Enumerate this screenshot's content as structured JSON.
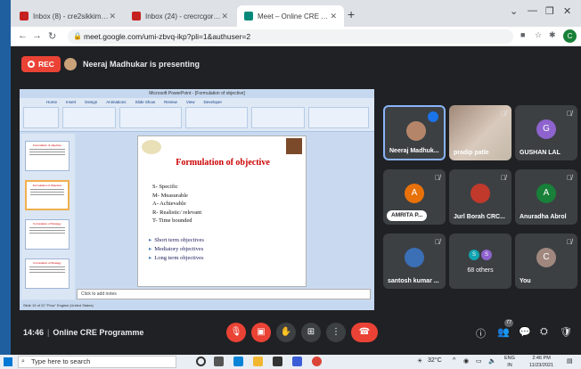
{
  "browser": {
    "tabs": [
      {
        "label": "Inbox (8) - cre2sikkim@gmail.co...",
        "favicon_color": "#c5221f",
        "active": false
      },
      {
        "label": "Inbox (24) - crecrcgorakhpur202...",
        "favicon_color": "#c5221f",
        "active": false
      },
      {
        "label": "Meet – Online CRE Programme",
        "favicon_color": "#00897b",
        "active": true
      }
    ],
    "url": "meet.google.com/umi-zbvq-ikp?pli=1&authuser=2",
    "profile_initial": "C"
  },
  "meet": {
    "rec_label": "REC",
    "presenting_text": "Neeraj Madhukar is presenting",
    "clock": "14:46",
    "meeting_name": "Online CRE Programme",
    "participant_count": "77"
  },
  "slide": {
    "app_title": "Microsoft PowerPoint - [Formulation of objective]",
    "ribbon_tabs": [
      "Home",
      "Insert",
      "Design",
      "Animations",
      "Slide Show",
      "Review",
      "View",
      "Developer"
    ],
    "title": "Formulation of objective",
    "smart": [
      "S- Specific",
      "M- Measurable",
      "A- Achievable",
      "R- Realistic/ relevant",
      "T- Time bounded"
    ],
    "bullets": [
      "Short term objectives",
      "Mediatory objectives",
      "Long term objectives"
    ],
    "notes_placeholder": "Click to add notes",
    "status_text": "Slide 19 of 22   \"Flow\"   English (United States)",
    "thumb_titles": [
      "Formulation of objective",
      "Formulation of Objective",
      "Formulation of Strategy",
      "Formulation of Strategy"
    ]
  },
  "participants": [
    {
      "name": "Neeraj Madhuk...",
      "type": "photo",
      "speaking": true
    },
    {
      "name": "pradip patle",
      "type": "camera",
      "muted": true
    },
    {
      "name": "GUSHAN LAL",
      "type": "initial",
      "initial": "G",
      "color": "#8e63ce",
      "muted": true
    },
    {
      "name": "AMRITA P...",
      "type": "initial",
      "initial": "A",
      "color": "#e8710a",
      "muted": true,
      "chip": true
    },
    {
      "name": "Jurl Borah CRC...",
      "type": "photo",
      "muted": true
    },
    {
      "name": "Anuradha Abrol",
      "type": "initial",
      "initial": "A",
      "color": "#188038",
      "muted": true
    },
    {
      "name": "santosh kumar ...",
      "type": "photo",
      "muted": true
    },
    {
      "name": "68 others",
      "type": "others",
      "initials": [
        "S",
        "S"
      ]
    },
    {
      "name": "You",
      "type": "initial",
      "initial": "C",
      "color": "#a1887f",
      "muted": true
    }
  ],
  "taskbar": {
    "search_placeholder": "Type here to search",
    "temperature": "32°C",
    "language": "ENG",
    "region": "IN",
    "time": "2:46 PM",
    "date": "11/23/2021"
  },
  "colors": {
    "meet_bg": "#202124",
    "tile_bg": "#3c4043",
    "danger": "#ea4335",
    "slide_title": "#cc0000",
    "speaking_border": "#8ab4f8"
  },
  "icons": {
    "controls": [
      "mic-off-icon",
      "camera-off-icon",
      "hand-icon",
      "present-icon",
      "more-icon",
      "hang-up-icon"
    ],
    "right_controls": [
      "info-icon",
      "people-icon",
      "chat-icon",
      "activities-icon",
      "host-controls-icon"
    ]
  }
}
